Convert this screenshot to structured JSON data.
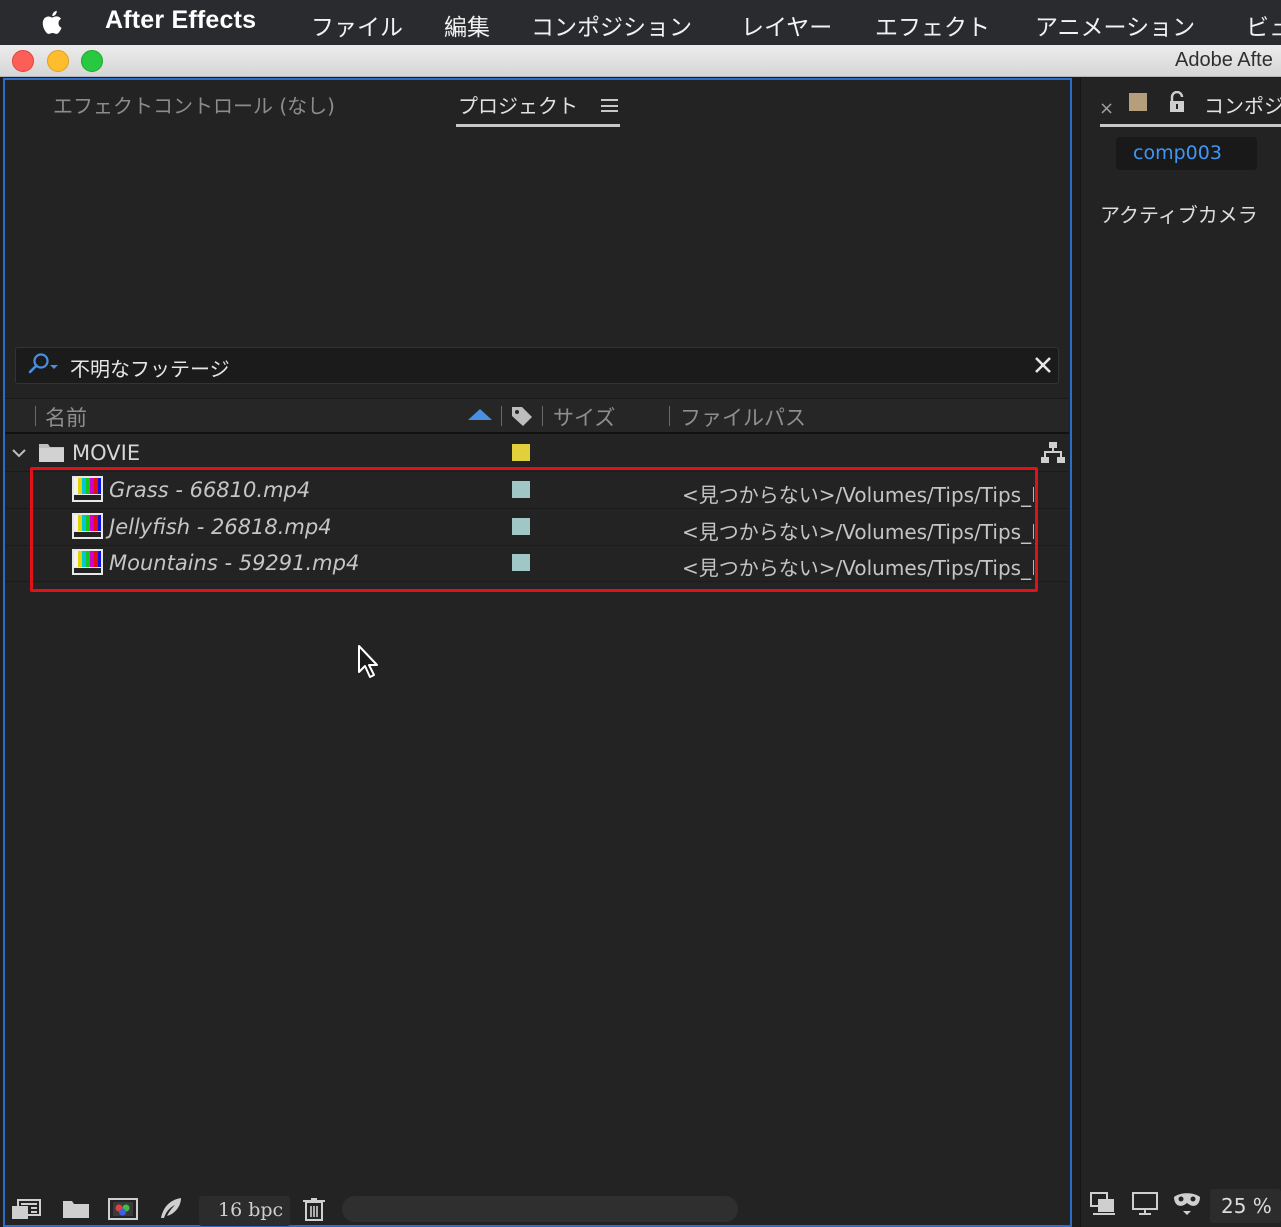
{
  "menubar": {
    "app_name": "After Effects",
    "items": [
      "ファイル",
      "編集",
      "コンポジション",
      "レイヤー",
      "エフェクト",
      "アニメーション",
      "ビュ"
    ]
  },
  "window": {
    "title": "Adobe Afte"
  },
  "project_panel": {
    "tabs": [
      {
        "label": "エフェクトコントロール (なし)",
        "active": false
      },
      {
        "label": "プロジェクト",
        "active": true
      }
    ],
    "search": {
      "value": "不明なフッテージ"
    },
    "columns": {
      "name": "名前",
      "size": "サイズ",
      "file_path": "ファイルパス"
    },
    "folder": {
      "name": "MOVIE",
      "label_color": "#e2cf3c",
      "expanded": true
    },
    "items": [
      {
        "name": "Grass - 66810.mp4",
        "label_color": "#9ec7c6",
        "path": "<見つからない>/Volumes/Tips/Tips_I"
      },
      {
        "name": "Jellyfish - 26818.mp4",
        "label_color": "#9ec7c6",
        "path": "<見つからない>/Volumes/Tips/Tips_I"
      },
      {
        "name": "Mountains - 59291.mp4",
        "label_color": "#9ec7c6",
        "path": "<見つからない>/Volumes/Tips/Tips_I"
      }
    ],
    "highlight_color": "#e3101a",
    "bit_depth": "16 bpc"
  },
  "comp_panel": {
    "tab_label": "コンポジ",
    "comp_name": "comp003",
    "camera": "アクティブカメラ",
    "zoom": "25 %",
    "label_color": "#b49e7c"
  },
  "icons": {
    "apple": "apple-icon",
    "search": "search-icon",
    "clear": "close-icon",
    "sort": "sort-ascending-icon",
    "tag": "label-tag-icon",
    "folder": "folder-icon",
    "footage": "footage-color-bars-icon",
    "flowchart": "flowchart-icon",
    "trash": "trash-icon"
  }
}
